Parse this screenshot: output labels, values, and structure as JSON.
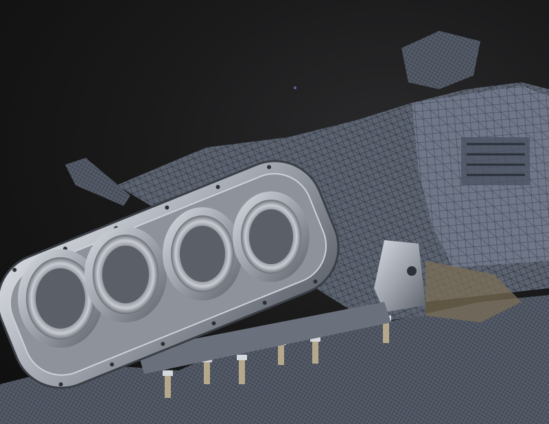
{
  "scene": {
    "description_visible_text": "",
    "colors": {
      "background": "#141414",
      "mesh_surface": "#5d6471",
      "mesh_wire": "#2a2f38",
      "mesh_highlight": "#8a93a3",
      "machined_metal": "#b8bcc4",
      "metal_dark": "#555a62",
      "brass": "#8a7a5c"
    },
    "objects": [
      "engine-block-scan-mesh",
      "intake-flange-plate",
      "throttle-body-bores",
      "fuel-injectors",
      "plenum-mesh",
      "valve-cover-mesh"
    ]
  }
}
